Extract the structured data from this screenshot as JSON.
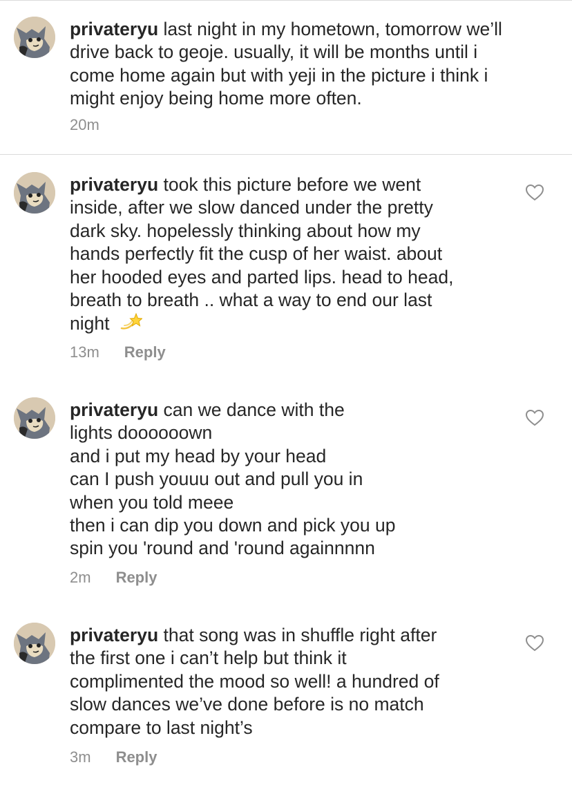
{
  "comments": [
    {
      "username": "privateryu",
      "lines": [
        "last night in my hometown, tomorrow we’ll",
        "drive back to geoje. usually, it will be months until i",
        "come home again but with yeji in the picture i think i",
        "might enjoy being home more often."
      ],
      "time": "20m",
      "avatar_icon": "cartoon-cat-avatar"
    },
    {
      "username": "privateryu",
      "lines": [
        "took this picture before we went",
        "inside, after we slow danced under the pretty",
        "dark sky. hopelessly thinking about how my",
        "hands perfectly fit the cusp of her waist. about",
        "her hooded eyes and parted lips. head to head,",
        "breath to breath .. what a way to end our last",
        "night"
      ],
      "emoji": "dizzy-star-emoji",
      "time": "13m",
      "reply": "Reply",
      "like_icon": "heart-outline-icon"
    },
    {
      "username": "privateryu",
      "lines": [
        "can we dance with the",
        "lights doooooown",
        "and i put my head by your head",
        "can I push youuu out and pull you in",
        "when you told meee",
        "then i can dip you down and pick you up",
        "spin you 'round and 'round againnnnn"
      ],
      "time": "2m",
      "reply": "Reply",
      "like_icon": "heart-outline-icon"
    },
    {
      "username": "privateryu",
      "lines": [
        "that song was in shuffle right after",
        "the first one i can’t help but think it",
        "complimented the mood so well! a hundred of",
        "slow dances we’ve done before is no match",
        "compare to last night’s"
      ],
      "time": "3m",
      "reply": "Reply",
      "like_icon": "heart-outline-icon"
    }
  ],
  "colors": {
    "text": "#262626",
    "meta": "#8e8e8e",
    "divider": "#dbdbdb"
  }
}
